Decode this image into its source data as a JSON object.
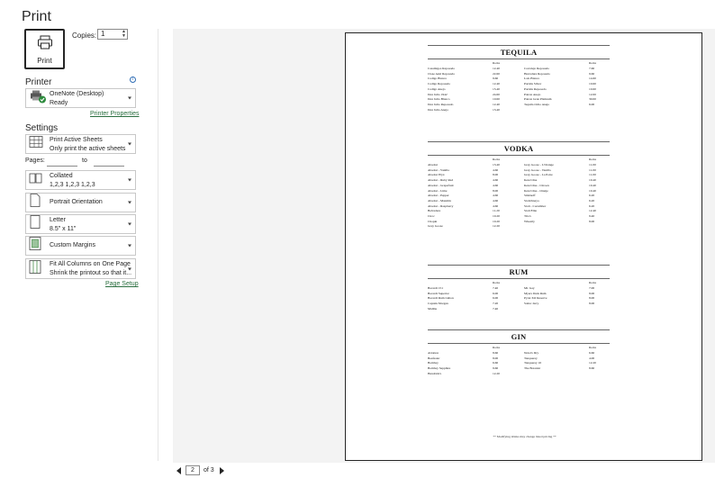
{
  "panel": {
    "title": "Print"
  },
  "print_button": {
    "label": "Print"
  },
  "copies": {
    "label": "Copies:",
    "value": "1"
  },
  "printer": {
    "heading": "Printer",
    "name": "OneNote (Desktop)",
    "status": "Ready",
    "properties_link": "Printer Properties"
  },
  "settings": {
    "heading": "Settings",
    "what": {
      "line1": "Print Active Sheets",
      "line2": "Only print the active sheets"
    },
    "pages_label": "Pages:",
    "to_label": "to",
    "collate": {
      "line1": "Collated",
      "line2": "1,2,3    1,2,3    1,2,3"
    },
    "orientation": {
      "line1": "Portrait Orientation"
    },
    "paper": {
      "line1": "Letter",
      "line2": "8.5\" x 11\""
    },
    "margins": {
      "line1": "Custom Margins"
    },
    "scaling": {
      "line1": "Fit All Columns on One Page",
      "line2": "Shrink the printout so that it..."
    },
    "page_setup_link": "Page Setup"
  },
  "pager": {
    "current": "2",
    "of": "of 3"
  },
  "menu": {
    "price_header": "Rocks",
    "sections": [
      {
        "title": "TEQUILA",
        "left": [
          [
            "Casamigos Reposado",
            "12.40"
          ],
          [
            "Clase Azul Reposado",
            "22.60"
          ],
          [
            "Codigo Blanco",
            "9.60"
          ],
          [
            "Codigo Reposado",
            "12.40"
          ],
          [
            "Codigo Anejo",
            "15.40"
          ],
          [
            "Don Julio 1942",
            "24.60"
          ],
          [
            "Don Julio Blanco",
            "10.60"
          ],
          [
            "Don Julio Reposado",
            "12.40"
          ],
          [
            "Don Julio Anejo",
            "13.40"
          ]
        ],
        "right": [
          [
            "Corralejo Reposado",
            "7.60"
          ],
          [
            "Herradura Reposado",
            "9.60"
          ],
          [
            "Lalo Blanco",
            "14.60"
          ],
          [
            "Partida Silver",
            "10.60"
          ],
          [
            "Partida Reposado",
            "10.60"
          ],
          [
            "Patron Anejo",
            "12.00"
          ],
          [
            "Patron Gran Platinum",
            "30.00"
          ],
          [
            "Tequila Ocho Anejo",
            "6.00"
          ]
        ]
      },
      {
        "title": "VODKA",
        "left": [
          [
            "Absolut",
            "13.40"
          ],
          [
            "Absolut - Vanilla",
            "4.60"
          ],
          [
            "Absolut Elyx",
            "8.00"
          ],
          [
            "Absolut - Ruby Red",
            "4.60"
          ],
          [
            "Absolut - Grapefruit",
            "4.60"
          ],
          [
            "Absolut - Lime",
            "8.00"
          ],
          [
            "Absolut - Pepper",
            "4.60"
          ],
          [
            "Absolut - Mandrin",
            "4.60"
          ],
          [
            "Absolut - Raspberry",
            "4.60"
          ],
          [
            "Belvedere",
            "11.20"
          ],
          [
            "Ciroc",
            "10.20"
          ],
          [
            "Chopin",
            "10.20"
          ],
          [
            "Grey Goose",
            "12.20"
          ]
        ],
        "right": [
          [
            "Grey Goose - L'Orange",
            "11.00"
          ],
          [
            "Grey Goose - Vanilla",
            "11.00"
          ],
          [
            "Grey Goose - La Poire",
            "11.00"
          ],
          [
            "Ketel One",
            "10.40"
          ],
          [
            "Ketel One - Citroen",
            "10.40"
          ],
          [
            "Ketel One - Oranje",
            "10.40"
          ],
          [
            "Smirnoff",
            "6.20"
          ],
          [
            "Stolichnaya",
            "6.20"
          ],
          [
            "Stoli - Cucumber",
            "6.20"
          ],
          [
            "Stoli Elite",
            "12.40"
          ],
          [
            "Tito's",
            "9.40"
          ],
          [
            "Wheatly",
            "8.00"
          ]
        ]
      },
      {
        "title": "RUM",
        "left": [
          [
            "Bacardi 151",
            "7.40"
          ],
          [
            "Bacardi Superior",
            "6.00"
          ],
          [
            "Bacardi Rum Limon",
            "6.00"
          ],
          [
            "Captain Morgan",
            "7.20"
          ],
          [
            "Malibu",
            "7.40"
          ]
        ],
        "right": [
          [
            "Mt. Gay",
            "7.00"
          ],
          [
            "Myers Dark Rum",
            "8.00"
          ],
          [
            "Pyrat XO Reserve",
            "8.00"
          ],
          [
            "Sailor Jerry",
            "8.00"
          ]
        ]
      },
      {
        "title": "GIN",
        "left": [
          [
            "Aviation",
            "8.60"
          ],
          [
            "Beefeater",
            "8.00"
          ],
          [
            "Bombay",
            "6.60"
          ],
          [
            "Bombay Sapphire",
            "9.60"
          ],
          [
            "Hendrick's",
            "12.20"
          ]
        ],
        "right": [
          [
            "Nolet's Dry",
            "6.60"
          ],
          [
            "Tanqueray",
            "4.00"
          ],
          [
            "Tanqueray 10",
            "12.20"
          ],
          [
            "The Botanist",
            "8.60"
          ]
        ]
      }
    ],
    "footnote": "** Modifying drinks may change listed pricing **"
  },
  "colors": {
    "accent_link": "#2a6e3f",
    "info": "#2f6db5"
  }
}
